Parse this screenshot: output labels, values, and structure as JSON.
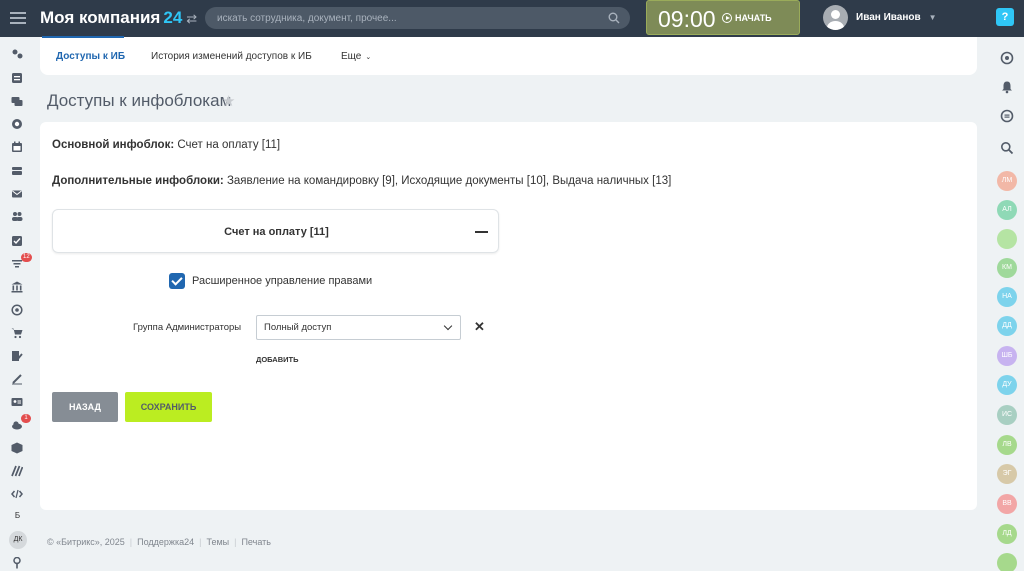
{
  "header": {
    "company": "Моя компания",
    "company_num": "24",
    "search_placeholder": "искать сотрудника, документ, прочее...",
    "time": "09:00",
    "start_label": "НАЧАТЬ",
    "user_name": "Иван Иванов",
    "help": "?"
  },
  "left_sidebar": {
    "badge_tasks": "12",
    "badge_cloud": "1",
    "letter_b": "Б",
    "initials": "ДК"
  },
  "right_sidebar": {
    "contacts": [
      {
        "initials": "ЛМ",
        "color": "#f2b8a7"
      },
      {
        "initials": "АЛ",
        "color": "#8fd9b6"
      },
      {
        "initials": "",
        "color": "#b5e4a3"
      },
      {
        "initials": "КМ",
        "color": "#9fd99b"
      },
      {
        "initials": "НА",
        "color": "#7dd3ec"
      },
      {
        "initials": "ДД",
        "color": "#7dd3ec"
      },
      {
        "initials": "ШБ",
        "color": "#c7b3f0"
      },
      {
        "initials": "ДУ",
        "color": "#7dd3ec"
      },
      {
        "initials": "ИС",
        "color": "#a8cfc2"
      },
      {
        "initials": "ЛВ",
        "color": "#a6d98c"
      },
      {
        "initials": "ЭГ",
        "color": "#d7c9a8"
      },
      {
        "initials": "ВВ",
        "color": "#f2a6a6"
      },
      {
        "initials": "ЛД",
        "color": "#a6d98c"
      },
      {
        "initials": "",
        "color": "#a6d98c"
      }
    ]
  },
  "tabs": [
    {
      "label": "Доступы к ИБ"
    },
    {
      "label": "История изменений доступов к ИБ"
    },
    {
      "label": "Еще"
    }
  ],
  "page_title": "Доступы к инфоблокам",
  "main": {
    "main_iblock_label": "Основной инфоблок:",
    "main_iblock_value": "Счет на оплату [11]",
    "extra_iblocks_label": "Дополнительные инфоблоки:",
    "extra_iblocks_value": "Заявление на командировку [9], Исходящие документы [10], Выдача наличных [13]",
    "section_title": "Счет на оплату [11]",
    "extended_rights_label": "Расширенное управление правами",
    "group_label": "Группа Администраторы",
    "access_value": "Полный доступ",
    "add_label": "ДОБАВИТЬ",
    "back_label": "НАЗАД",
    "save_label": "СОХРАНИТЬ"
  },
  "footer": {
    "copyright": "© «Битрикс», 2025",
    "support": "Поддержка24",
    "themes": "Темы",
    "print": "Печать"
  }
}
